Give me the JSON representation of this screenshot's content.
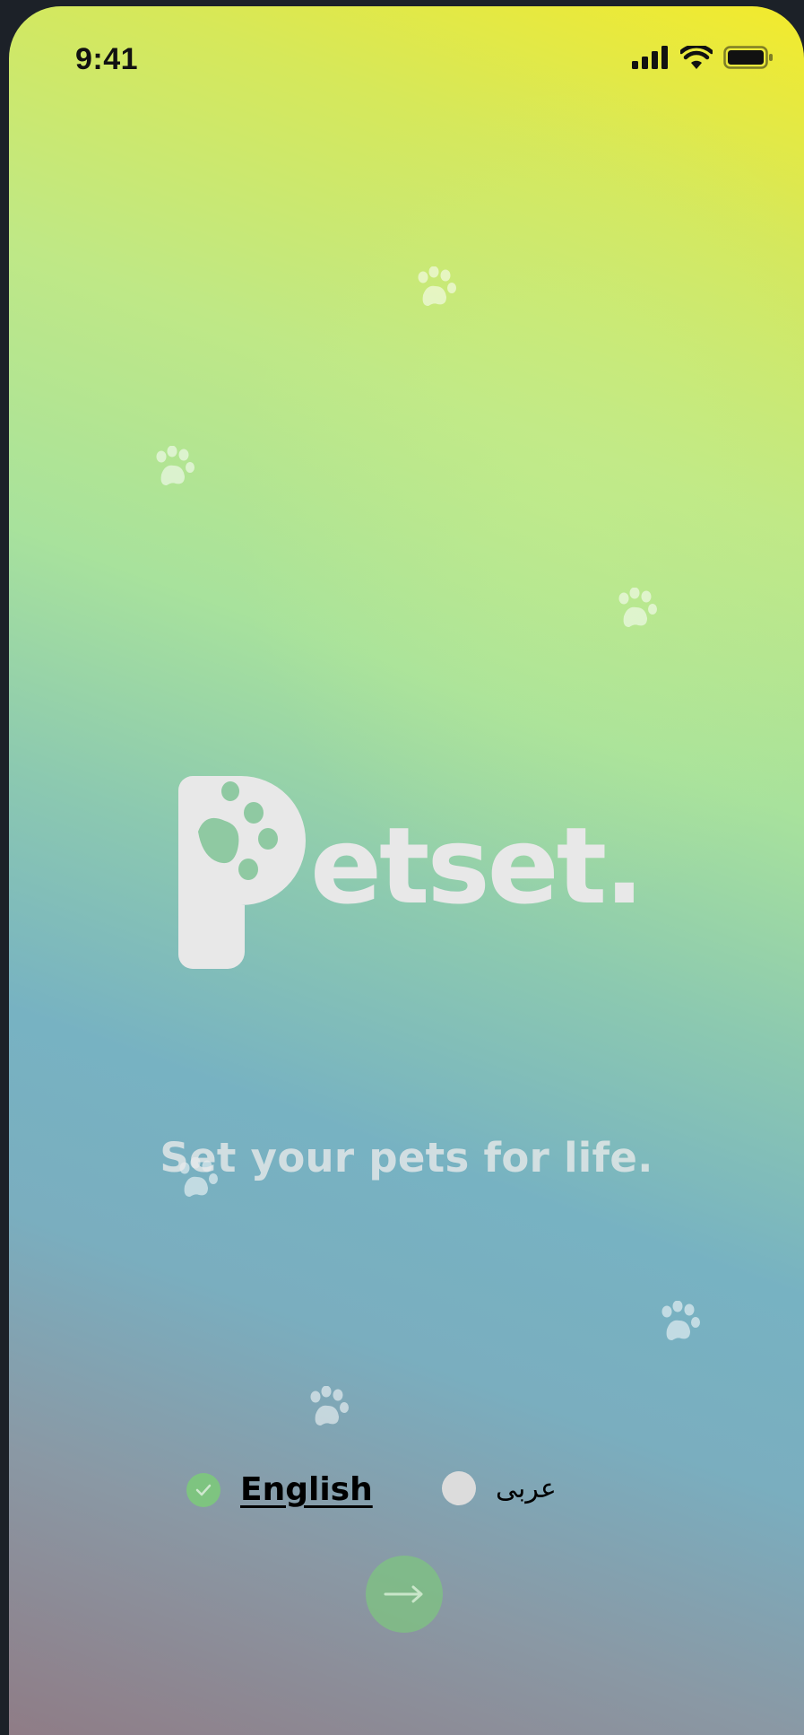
{
  "status_bar": {
    "time": "9:41",
    "icons": [
      "signal-icon",
      "wifi-icon",
      "battery-icon"
    ]
  },
  "brand": {
    "name": "Petset.",
    "word_after_p": "etset.",
    "tagline": "Set your pets for life."
  },
  "language": {
    "options": [
      {
        "label": "English",
        "selected": true
      },
      {
        "label": "عربى",
        "selected": false
      }
    ]
  },
  "next_button": {
    "icon": "arrow-right-icon"
  },
  "colors": {
    "accent_green": "#7ec480",
    "logo_fill": "#e8e8e8",
    "gradient_top": "#f3ea2c",
    "gradient_mid": "#a8e29c",
    "gradient_bottom": "#8f7c86"
  },
  "decorations": {
    "icon": "paw-icon"
  }
}
